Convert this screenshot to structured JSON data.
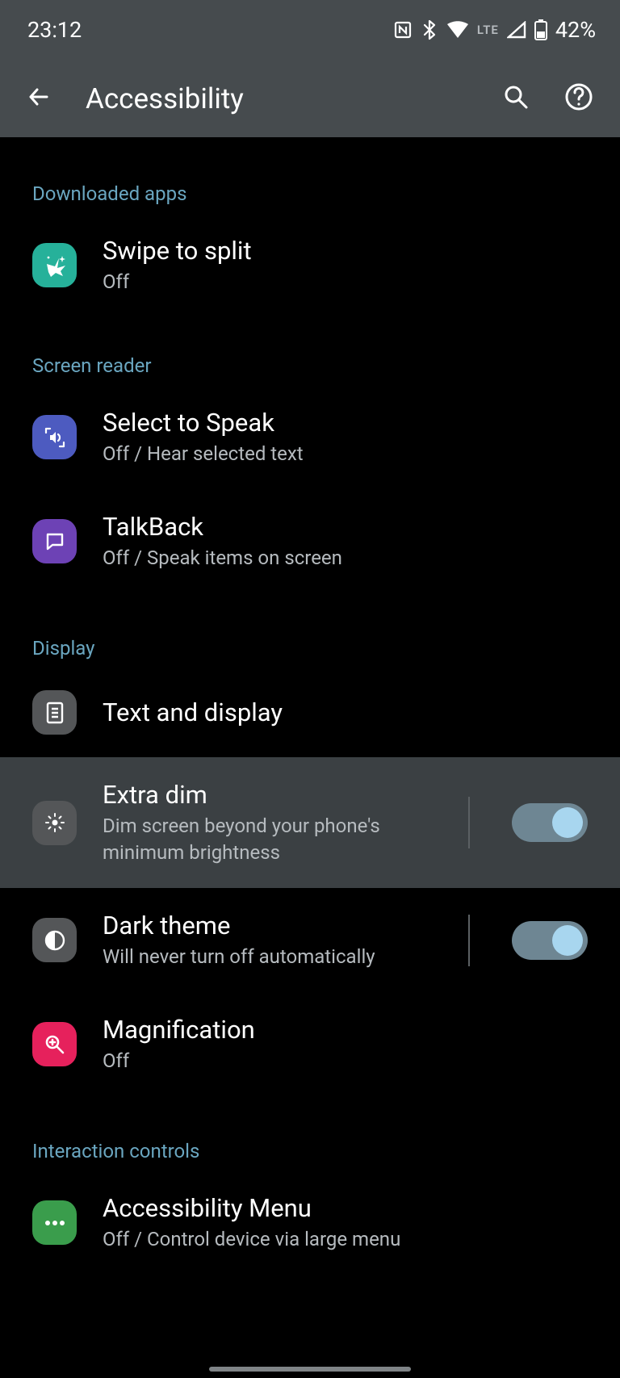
{
  "status": {
    "time": "23:12",
    "lte": "LTE",
    "battery": "42%"
  },
  "appbar": {
    "title": "Accessibility"
  },
  "sections": {
    "downloaded": "Downloaded apps",
    "screen_reader": "Screen reader",
    "display": "Display",
    "interaction": "Interaction controls"
  },
  "items": {
    "swipe_split": {
      "title": "Swipe to split",
      "sub": "Off"
    },
    "select_speak": {
      "title": "Select to Speak",
      "sub": "Off / Hear selected text"
    },
    "talkback": {
      "title": "TalkBack",
      "sub": "Off / Speak items on screen"
    },
    "text_display": {
      "title": "Text and display"
    },
    "extra_dim": {
      "title": "Extra dim",
      "sub": "Dim screen beyond your phone's minimum brightness"
    },
    "dark_theme": {
      "title": "Dark theme",
      "sub": "Will never turn off automatically"
    },
    "magnification": {
      "title": "Magnification",
      "sub": "Off"
    },
    "a11y_menu": {
      "title": "Accessibility Menu",
      "sub": "Off / Control device via large menu"
    }
  },
  "toggles": {
    "extra_dim": true,
    "dark_theme": true
  }
}
